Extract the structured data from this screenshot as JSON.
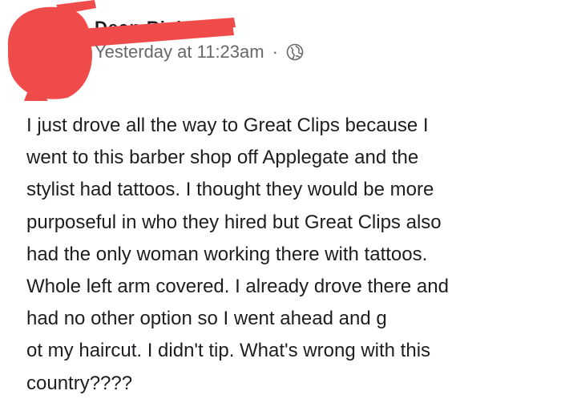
{
  "post": {
    "author_name": "Dean Rickey",
    "timestamp": "Yesterday at 11:23am",
    "separator": "·",
    "privacy_icon": "globe-icon",
    "body_lines": [
      "I just drove all the way to Great Clips because I",
      "went to this barber shop off Applegate and the",
      "stylist had tattoos. I thought they would be more",
      "purposeful in who they hired but Great Clips also",
      "had the only woman working there with tattoos.",
      "Whole left arm covered. I already drove there and",
      "had no other option so I went ahead and g",
      "ot my haircut. I didn't tip. What's wrong with this",
      "country????"
    ]
  },
  "colors": {
    "redaction": "#f04b4b",
    "text": "#1c1e21",
    "meta": "#65676b"
  }
}
